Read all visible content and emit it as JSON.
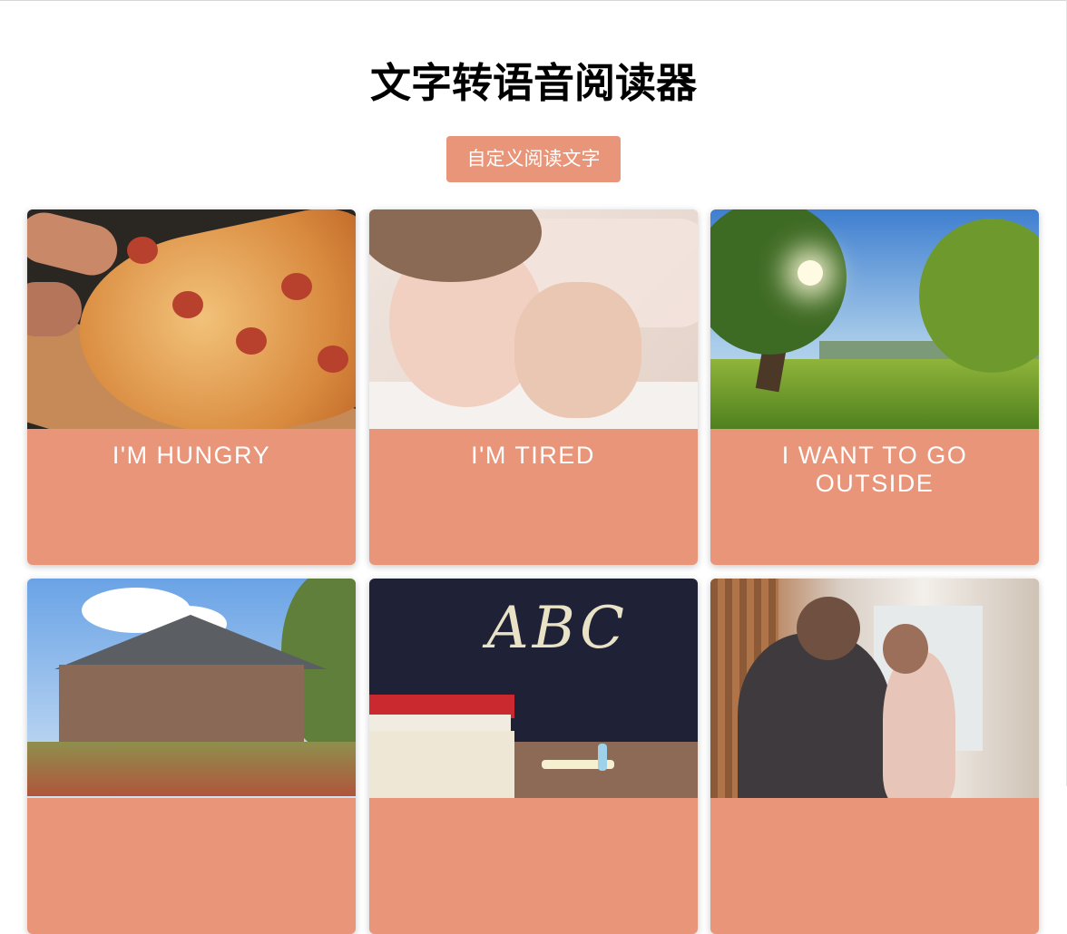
{
  "page": {
    "title": "文字转语音阅读器",
    "custom_button_label": "自定义阅读文字"
  },
  "cards": [
    {
      "label": "I'm Hungry",
      "image": "pizza"
    },
    {
      "label": "I'm Tired",
      "image": "sleeping-child"
    },
    {
      "label": "I Want To Go Outside",
      "image": "park"
    },
    {
      "label": "",
      "image": "house"
    },
    {
      "label": "",
      "image": "abc-chalkboard"
    },
    {
      "label": "",
      "image": "grandmother-child-window"
    }
  ],
  "colors": {
    "accent": "#e9957a",
    "background": "#ffffff",
    "text": "#000000"
  }
}
